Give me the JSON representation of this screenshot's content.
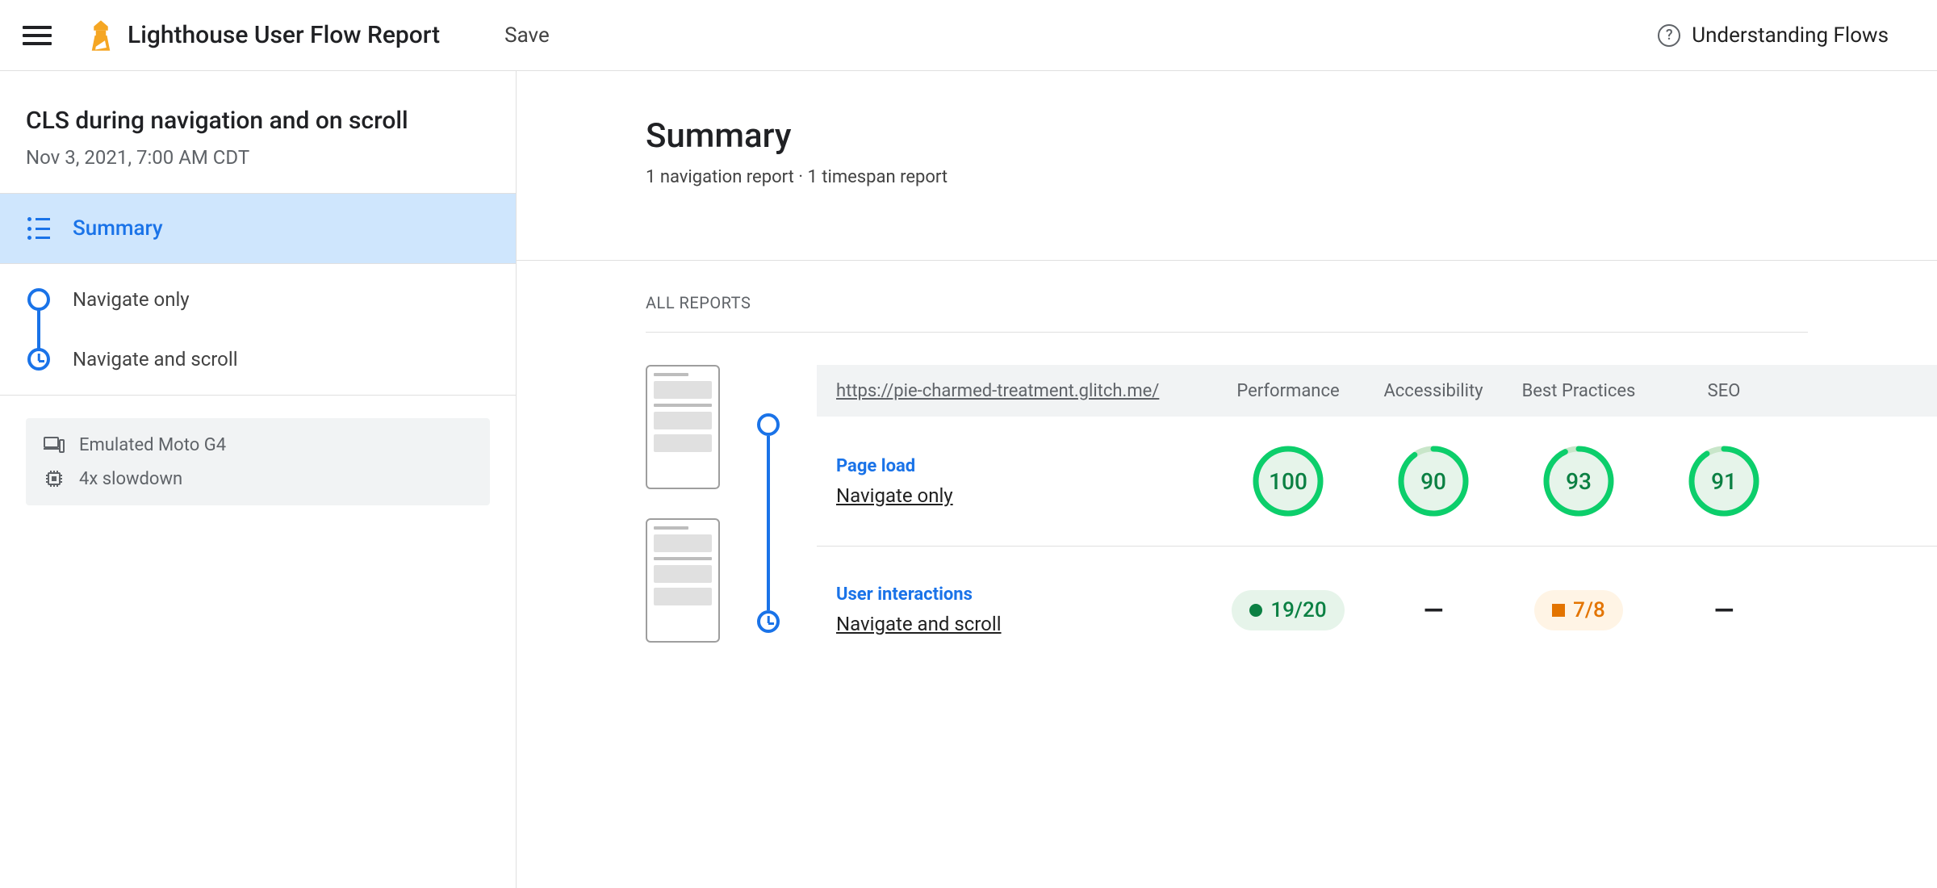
{
  "topbar": {
    "app_title": "Lighthouse User Flow Report",
    "save_label": "Save",
    "help_label": "Understanding Flows"
  },
  "sidebar": {
    "flow_title": "CLS during navigation and on scroll",
    "flow_date": "Nov 3, 2021, 7:00 AM CDT",
    "summary_label": "Summary",
    "steps": [
      {
        "label": "Navigate only",
        "kind": "navigation"
      },
      {
        "label": "Navigate and scroll",
        "kind": "timespan"
      }
    ],
    "env": {
      "device": "Emulated Moto G4",
      "cpu": "4x slowdown"
    }
  },
  "main": {
    "title": "Summary",
    "subtitle": "1 navigation report · 1 timespan report",
    "section_label": "ALL REPORTS",
    "table": {
      "url": "https://pie-charmed-treatment.glitch.me/",
      "cols": [
        "Performance",
        "Accessibility",
        "Best Practices",
        "SEO"
      ],
      "rows": [
        {
          "kind": "navigation",
          "title": "Page load",
          "name": "Navigate only",
          "scores": [
            {
              "type": "gauge",
              "value": 100
            },
            {
              "type": "gauge",
              "value": 90
            },
            {
              "type": "gauge",
              "value": 93
            },
            {
              "type": "gauge",
              "value": 91
            }
          ]
        },
        {
          "kind": "timespan",
          "title": "User interactions",
          "name": "Navigate and scroll",
          "scores": [
            {
              "type": "fraction",
              "pass": 19,
              "total": 20,
              "status": "green"
            },
            {
              "type": "dash"
            },
            {
              "type": "fraction",
              "pass": 7,
              "total": 8,
              "status": "orange"
            },
            {
              "type": "dash"
            }
          ]
        }
      ]
    }
  }
}
